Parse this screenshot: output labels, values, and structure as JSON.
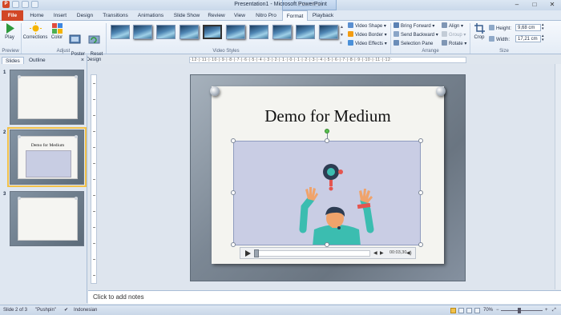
{
  "window": {
    "app_icon": "P",
    "title": "Presentation1 - Microsoft PowerPoint",
    "context_tab": "Video Tools",
    "controls": [
      "–",
      "□",
      "✕"
    ]
  },
  "tabs": {
    "file": "File",
    "items": [
      "Home",
      "Insert",
      "Design",
      "Transitions",
      "Animations",
      "Slide Show",
      "Review",
      "View",
      "Nitro Pro",
      "Format",
      "Playback"
    ],
    "active": "Format"
  },
  "ribbon": {
    "preview": {
      "play": "Play",
      "label": "Preview"
    },
    "adjust": {
      "corrections": "Corrections",
      "color": "Color",
      "poster_frame": "Poster\nFrame",
      "reset_design": "Reset\nDesign",
      "label": "Adjust"
    },
    "video_styles": {
      "label": "Video Styles",
      "count": 10
    },
    "video_effects": {
      "shape": "Video Shape",
      "border": "Video Border",
      "effects": "Video Effects"
    },
    "arrange": {
      "bring_forward": "Bring Forward",
      "send_backward": "Send Backward",
      "selection_pane": "Selection Pane",
      "align": "Align",
      "group": "Group",
      "rotate": "Rotate",
      "label": "Arrange"
    },
    "size": {
      "crop": "Crop",
      "height_label": "Height:",
      "height_value": "9,68 cm",
      "width_label": "Width:",
      "width_value": "17,21 cm",
      "label": "Size"
    }
  },
  "left_panel": {
    "tabs": [
      "Slides",
      "Outline"
    ],
    "close": "×",
    "slides": [
      {
        "num": "1",
        "title": ""
      },
      {
        "num": "2",
        "title": "Demo for Medium"
      },
      {
        "num": "3",
        "title": ""
      }
    ]
  },
  "ruler": {
    "text": "·12·|·11·|·10·|·9·|·8·|·7·|·6·|·5·|·4·|·3·|·2·|·1·|·0·|·1·|·2·|·3·|·4·|·5·|·6·|·7·|·8·|·9·|·10·|·11·|·12·"
  },
  "slide": {
    "title": "Demo for Medium",
    "video": {
      "time": "00:03,30"
    }
  },
  "notes": {
    "placeholder": "Click to add notes"
  },
  "status": {
    "slide": "Slide 2 of 3",
    "theme": "\"Pushpin\"",
    "language": "Indonesian",
    "zoom": "70%"
  },
  "colors": {
    "file_tab": "#d24726",
    "selection": "#f2c14a",
    "video_bg": "#c9cde4",
    "character_shirt": "#3bbdb0"
  }
}
